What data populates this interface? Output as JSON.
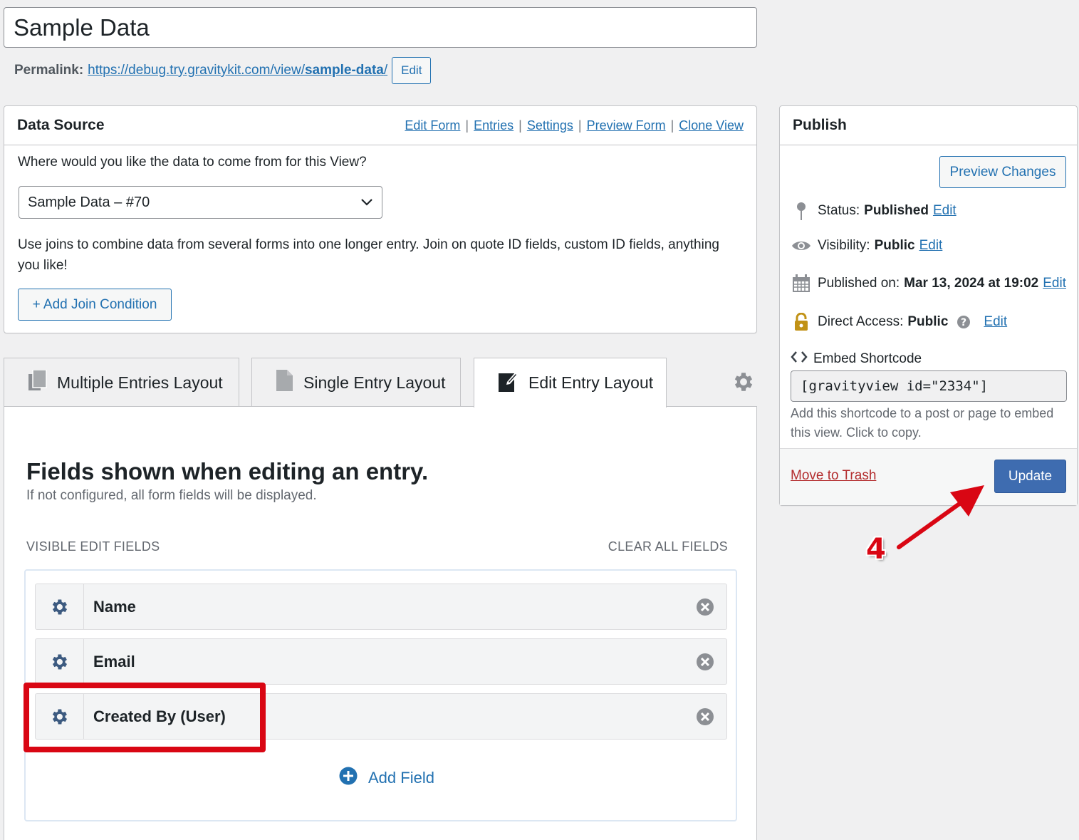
{
  "title": "Sample Data",
  "permalink": {
    "label": "Permalink:",
    "url_base": "https://debug.try.gravitykit.com/view/",
    "url_slug": "sample-data",
    "url_end": "/",
    "edit_label": "Edit"
  },
  "data_source": {
    "title": "Data Source",
    "links": [
      "Edit Form",
      "Entries",
      "Settings",
      "Preview Form",
      "Clone View"
    ],
    "separator": "|",
    "question": "Where would you like the data to come from for this View?",
    "selected_form": "Sample Data – #70",
    "join_text": "Use joins to combine data from several forms into one longer entry. Join on quote ID fields, custom ID fields, anything you like!",
    "add_join_label": "+ Add Join Condition"
  },
  "tabs": [
    {
      "label": "Multiple Entries Layout",
      "icon": "copy-icon",
      "active": false
    },
    {
      "label": "Single Entry Layout",
      "icon": "document-icon",
      "active": false
    },
    {
      "label": "Edit Entry Layout",
      "icon": "edit-icon",
      "active": true
    }
  ],
  "edit_layout": {
    "heading": "Fields shown when editing an entry.",
    "subheading": "If not configured, all form fields will be displayed.",
    "visible_label": "VISIBLE EDIT FIELDS",
    "clear_all_label": "CLEAR ALL FIELDS",
    "fields": [
      "Name",
      "Email",
      "Created By (User)"
    ],
    "add_field_label": "Add Field"
  },
  "publish": {
    "title": "Publish",
    "preview_label": "Preview Changes",
    "status_label": "Status:",
    "status_value": "Published",
    "visibility_label": "Visibility:",
    "visibility_value": "Public",
    "published_label": "Published on:",
    "published_value": "Mar 13, 2024 at 19:02",
    "access_label": "Direct Access:",
    "access_value": "Public",
    "edit_label": "Edit",
    "embed_label": "Embed Shortcode",
    "shortcode": "[gravityview id=\"2334\"]",
    "embed_note": "Add this shortcode to a post or page to embed this view. Click to copy.",
    "trash_label": "Move to Trash",
    "update_label": "Update"
  },
  "annotation": {
    "number": "4",
    "color": "#d90613"
  },
  "colors": {
    "accent": "#2271b1",
    "danger": "#b32d2e",
    "update_button": "#3e6cb0"
  }
}
